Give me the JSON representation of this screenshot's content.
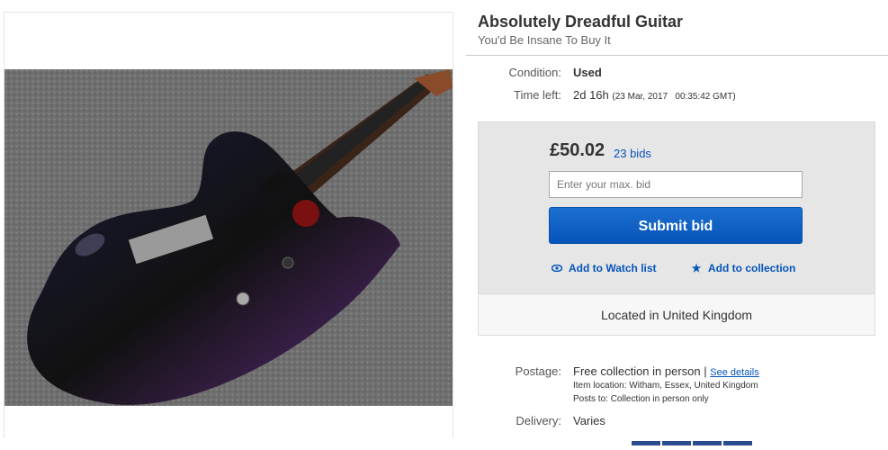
{
  "listing": {
    "title": "Absolutely Dreadful Guitar",
    "subtitle": "You'd Be Insane To Buy It"
  },
  "details": {
    "condition_label": "Condition:",
    "condition_value": "Used",
    "time_left_label": "Time left:",
    "time_left_value": "2d 16h",
    "time_left_date": "(23 Mar, 2017   00:35:42 GMT)"
  },
  "bidding": {
    "price": "£50.02",
    "bids": "23 bids",
    "input_placeholder": "Enter your max. bid",
    "submit_label": "Submit bid",
    "watch_label": "Add to Watch list",
    "collection_label": "Add to collection",
    "location": "Located in United Kingdom"
  },
  "postage": {
    "label": "Postage:",
    "value": "Free collection in person",
    "separator": "|",
    "see_details": "See details",
    "item_location_label": "Item location:",
    "item_location_value": "Witham, Essex, United Kingdom",
    "posts_to_label": "Posts to:",
    "posts_to_value": "Collection in person only"
  },
  "delivery": {
    "label": "Delivery:",
    "value": "Varies"
  },
  "colors": {
    "link": "#0654ba",
    "button": "#0654ba",
    "bid_box": "#e6e6e6"
  },
  "icons": {
    "watch": "eye-icon",
    "collection": "star-icon"
  }
}
